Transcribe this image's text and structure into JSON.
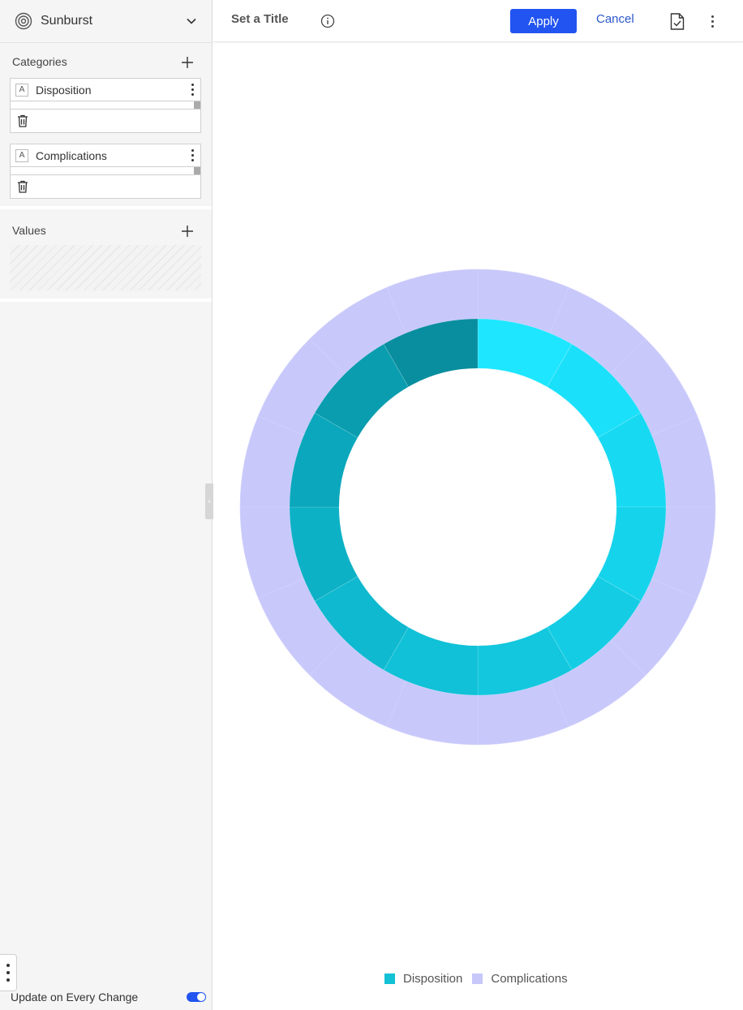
{
  "sidebar": {
    "chart_type": {
      "label": "Sunburst",
      "icon": "sunburst-icon"
    },
    "categories": {
      "title": "Categories",
      "fields": [
        {
          "type_badge": "A",
          "name": "Disposition"
        },
        {
          "type_badge": "A",
          "name": "Complications"
        }
      ]
    },
    "values": {
      "title": "Values"
    },
    "update_label": "Update on Every Change",
    "update_on_change": true
  },
  "topbar": {
    "title": "Set a Title",
    "apply_label": "Apply",
    "cancel_label": "Cancel"
  },
  "colors": {
    "accent": "#2154f0",
    "link": "#2c57c9",
    "disposition": "#12c1d5",
    "complications": "#c8c8fb"
  },
  "chart_data": {
    "type": "sunburst",
    "inner_ring": {
      "name": "Disposition",
      "segments": 12,
      "colors": [
        "#1ee6ff",
        "#1be0fa",
        "#18d9f2",
        "#16d3ec",
        "#14cde4",
        "#12c7de",
        "#10c1d7",
        "#0fb9cf",
        "#0db1c6",
        "#0ba7bc",
        "#0a9daf",
        "#098e9f"
      ]
    },
    "outer_ring": {
      "name": "Complications",
      "segments": 16,
      "color": "#c8c8fb"
    },
    "legend": [
      {
        "label": "Disposition",
        "color": "#12c1d5"
      },
      {
        "label": "Complications",
        "color": "#c8c8fb"
      }
    ],
    "legend_position": "bottom-center"
  }
}
